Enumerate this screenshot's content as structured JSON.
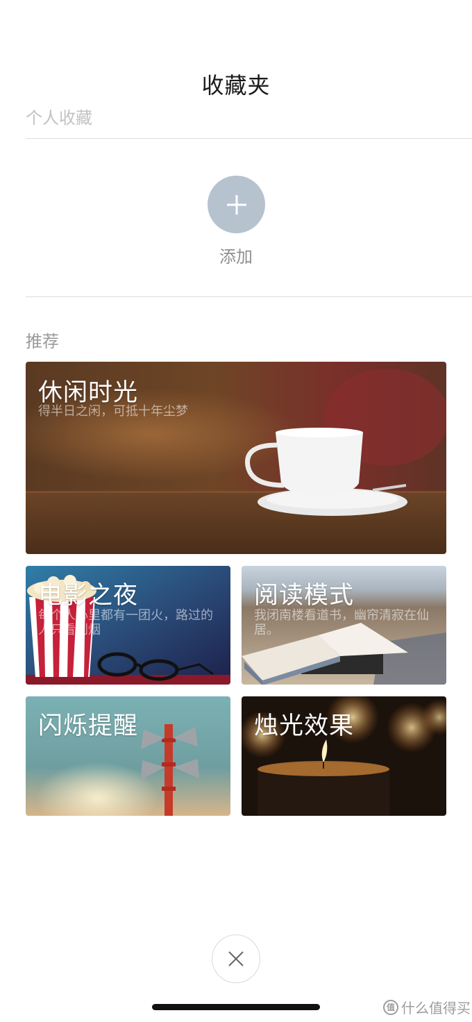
{
  "header": {
    "title": "收藏夹"
  },
  "personal": {
    "label": "个人收藏",
    "add_label": "添加",
    "add_icon": "plus-icon",
    "add_color": "#b7c2cf"
  },
  "recommend": {
    "label": "推荐",
    "cards": [
      {
        "title": "休闲时光",
        "subtitle": "得半日之闲，可抵十年尘梦"
      },
      {
        "title": "电影之夜",
        "subtitle": "每个人心里都有一团火，路过的人只看到烟"
      },
      {
        "title": "阅读模式",
        "subtitle": "我闭南楼看道书，幽帘清寂在仙居。"
      },
      {
        "title": "闪烁提醒",
        "subtitle": ""
      },
      {
        "title": "烛光效果",
        "subtitle": ""
      }
    ]
  },
  "footer": {
    "close_icon": "close-icon",
    "watermark": "什么值得买"
  }
}
